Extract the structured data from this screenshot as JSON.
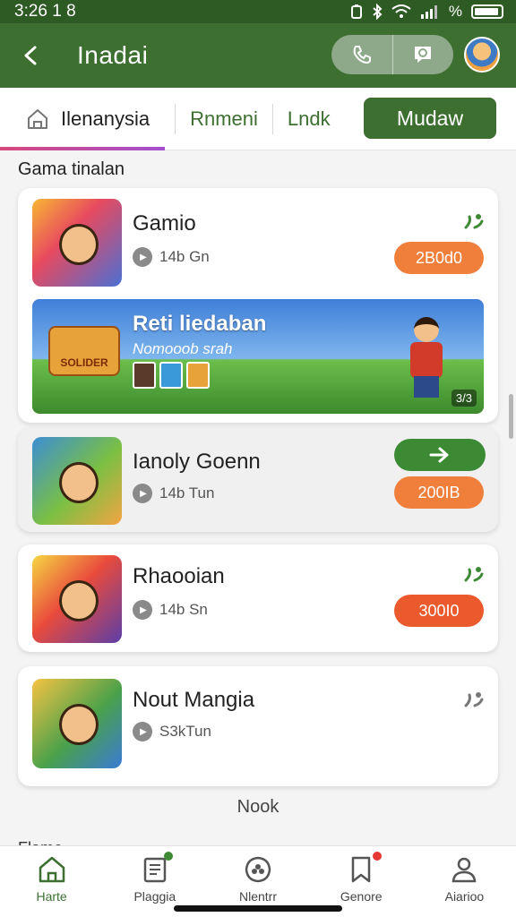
{
  "status_bar": {
    "time": "3:26 1 8",
    "icons": [
      "battery-saver-icon",
      "bluetooth-icon",
      "wifi-icon",
      "signal-icon",
      "percent-icon",
      "battery-icon"
    ]
  },
  "app_bar": {
    "title": "Inadai",
    "back_icon": "arrow-left-icon",
    "actions": [
      "phone-icon",
      "chat-icon"
    ],
    "avatar": "profile-avatar"
  },
  "tabs": [
    {
      "label": "Ilenanysia",
      "icon": "home-outline-icon",
      "active_underline": true
    },
    {
      "label": "Rnmeni"
    },
    {
      "label": "Lndk"
    },
    {
      "label": "Mudaw",
      "active": true
    }
  ],
  "section": {
    "title": "Gama tinalan"
  },
  "games": [
    {
      "name": "Gamio",
      "meta": "14b Gn",
      "price": "2B0d0",
      "price_color": "#ef7f3a",
      "action_icon": "sparkle-icon"
    },
    {
      "name": "Ianoly Goenn",
      "meta": "14b Tun",
      "price": "200IB",
      "price_color": "#ef7f3a",
      "action_icon": "arrow-right-icon"
    },
    {
      "name": "Rhaooian",
      "meta": "14b Sn",
      "price": "300I0",
      "price_color": "#ea5a2c",
      "action_icon": "sparkle-icon"
    },
    {
      "name": "Nout Mangia",
      "meta": "S3kTun",
      "action_icon": "sparkle-icon"
    }
  ],
  "banner": {
    "title": "Reti liedaban",
    "subtitle": "Nomooob srah",
    "badge_text": "SOLIDER",
    "count": "3/3"
  },
  "load_more": "Nook",
  "cutoff_text": "Flame ...",
  "bottom_nav": [
    {
      "label": "Harte",
      "icon": "home-icon",
      "active": true
    },
    {
      "label": "Plaggia",
      "icon": "document-icon",
      "dot_color": "#3d8a35"
    },
    {
      "label": "Nlentrr",
      "icon": "club-icon"
    },
    {
      "label": "Genore",
      "icon": "bookmark-icon",
      "dot_color": "#e53935"
    },
    {
      "label": "Aiarioo",
      "icon": "person-icon"
    }
  ],
  "colors": {
    "primary": "#3d6f31",
    "accent_orange": "#ef7f3a"
  }
}
